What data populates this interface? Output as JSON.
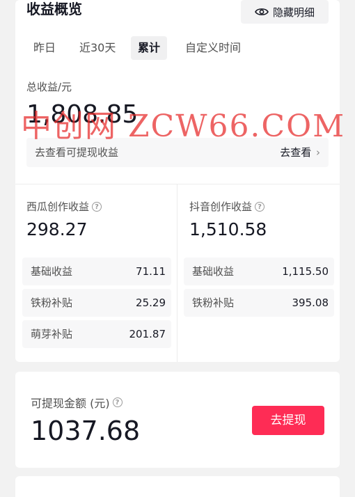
{
  "overview": {
    "title": "收益概览",
    "hide_details": "隐藏明细",
    "tabs": [
      {
        "label": "昨日",
        "active": false
      },
      {
        "label": "近30天",
        "active": false
      },
      {
        "label": "累计",
        "active": true
      },
      {
        "label": "自定义时间",
        "active": false
      }
    ],
    "total_label": "总收益/元",
    "total_value": "1,808.85",
    "withdrawable_link_text": "去查看可提现收益",
    "withdrawable_link_action": "去查看",
    "xigua": {
      "label": "西瓜创作收益",
      "value": "298.27",
      "rows": [
        {
          "key": "基础收益",
          "value": "71.11"
        },
        {
          "key": "铁粉补贴",
          "value": "25.29"
        },
        {
          "key": "萌芽补贴",
          "value": "201.87"
        }
      ]
    },
    "douyin": {
      "label": "抖音创作收益",
      "value": "1,510.58",
      "rows": [
        {
          "key": "基础收益",
          "value": "1,115.50"
        },
        {
          "key": "铁粉补贴",
          "value": "395.08"
        }
      ]
    }
  },
  "withdraw": {
    "label": "可提现金额 (元)",
    "value": "1037.68",
    "button": "去提现"
  },
  "watermark": "中创网 ZCW66.COM",
  "colors": {
    "accent": "#fe2c55",
    "text": "#161823",
    "muted": "#505050",
    "row_bg": "#f7f7f8"
  }
}
